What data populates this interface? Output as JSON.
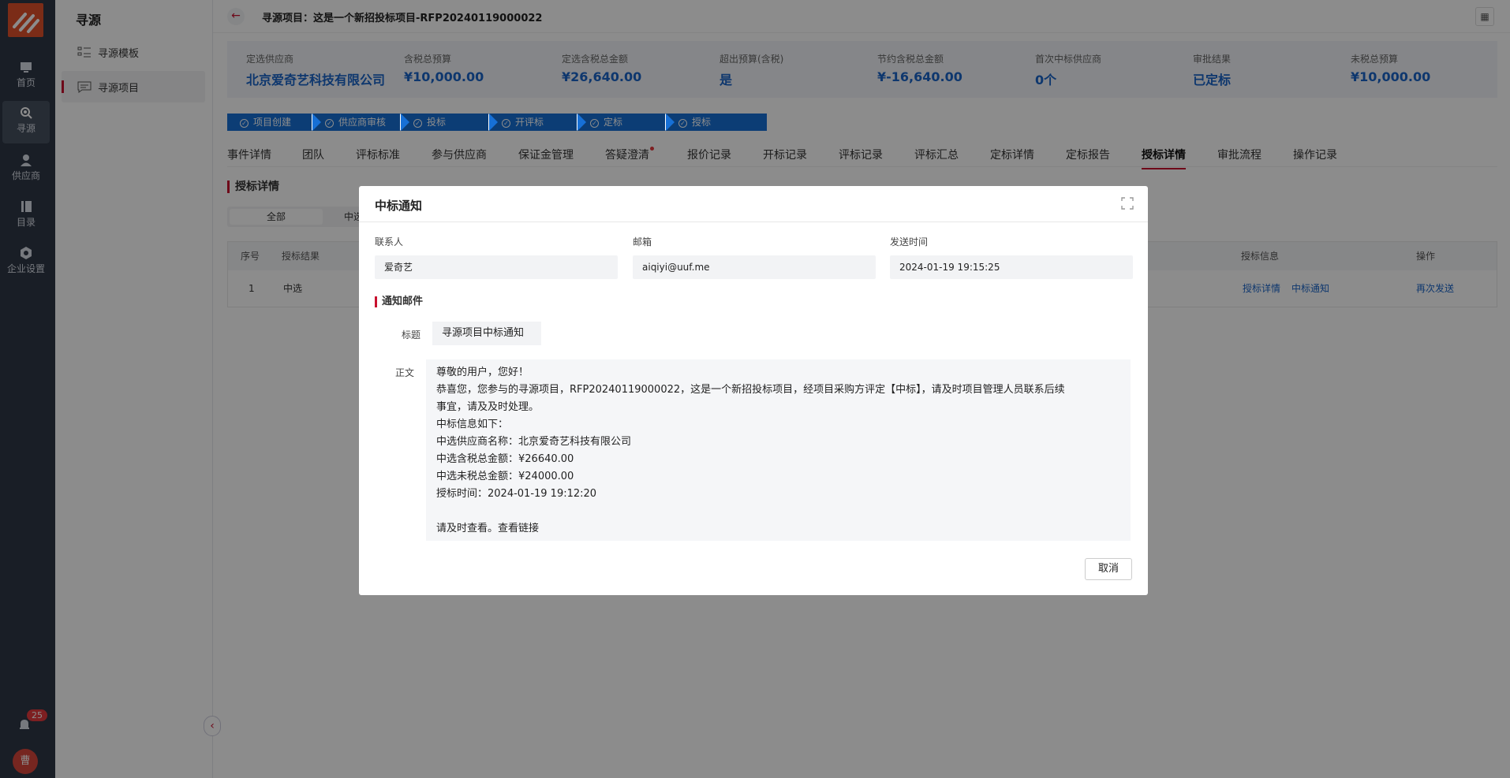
{
  "nav": {
    "items": [
      {
        "label": "首页",
        "icon": "home-icon"
      },
      {
        "label": "寻源",
        "icon": "sourcing-icon"
      },
      {
        "label": "供应商",
        "icon": "supplier-icon"
      },
      {
        "label": "目录",
        "icon": "catalog-icon"
      },
      {
        "label": "企业设置",
        "icon": "settings-icon"
      }
    ],
    "notification_count": "25",
    "avatar_text": "曹"
  },
  "subnav": {
    "title": "寻源",
    "items": [
      {
        "label": "寻源模板",
        "icon": "template-list-icon"
      },
      {
        "label": "寻源项目",
        "icon": "project-message-icon"
      }
    ]
  },
  "header": {
    "title": "寻源项目：这是一个新招投标项目-RFP20240119000022"
  },
  "summary": [
    {
      "label": "定选供应商",
      "value": "北京爱奇艺科技有限公司"
    },
    {
      "label": "含税总预算",
      "value": "¥10,000.00"
    },
    {
      "label": "定选含税总金额",
      "value": "¥26,640.00"
    },
    {
      "label": "超出预算(含税)",
      "value": "是"
    },
    {
      "label": "节约含税总金额",
      "value": "¥-16,640.00"
    },
    {
      "label": "首次中标供应商",
      "value": "0个"
    },
    {
      "label": "审批结果",
      "value": "已定标"
    },
    {
      "label": "未税总预算",
      "value": "¥10,000.00"
    }
  ],
  "steps": [
    "项目创建",
    "供应商审核",
    "投标",
    "开评标",
    "定标",
    "授标"
  ],
  "tabs": [
    "事件详情",
    "团队",
    "评标标准",
    "参与供应商",
    "保证金管理",
    "答疑澄清",
    "报价记录",
    "开标记录",
    "评标记录",
    "评标汇总",
    "定标详情",
    "定标报告",
    "授标详情",
    "审批流程",
    "操作记录"
  ],
  "section_title": "授标详情",
  "filters": [
    "全部",
    "中选"
  ],
  "table": {
    "headers": [
      "序号",
      "授标结果",
      "授标信息",
      "操作"
    ],
    "row": {
      "index": "1",
      "result": "中选",
      "detail_link": "授标详情",
      "notice_link": "中标通知",
      "resend_link": "再次发送"
    }
  },
  "modal": {
    "title": "中标通知",
    "contact_label": "联系人",
    "contact_value": "爱奇艺",
    "email_label": "邮箱",
    "email_value": "aiqiyi@uuf.me",
    "time_label": "发送时间",
    "time_value": "2024-01-19 19:15:25",
    "mail_section": "通知邮件",
    "subject_label": "标题",
    "subject_value": "寻源项目中标通知",
    "body_label": "正文",
    "body_lines": [
      "尊敬的用户，您好！",
      "恭喜您，您参与的寻源项目，RFP20240119000022，这是一个新招投标项目，经项目采购方评定【中标】，请及时项目管理人员联系后续",
      "事宜，请及及时处理。",
      "中标信息如下：",
      "中选供应商名称：北京爱奇艺科技有限公司",
      "中选含税总金额：¥26640.00",
      "中选未税总金额：¥24000.00",
      "授标时间：2024-01-19 19:12:20",
      "",
      "请及时查看。查看链接"
    ],
    "cancel_label": "取消"
  }
}
